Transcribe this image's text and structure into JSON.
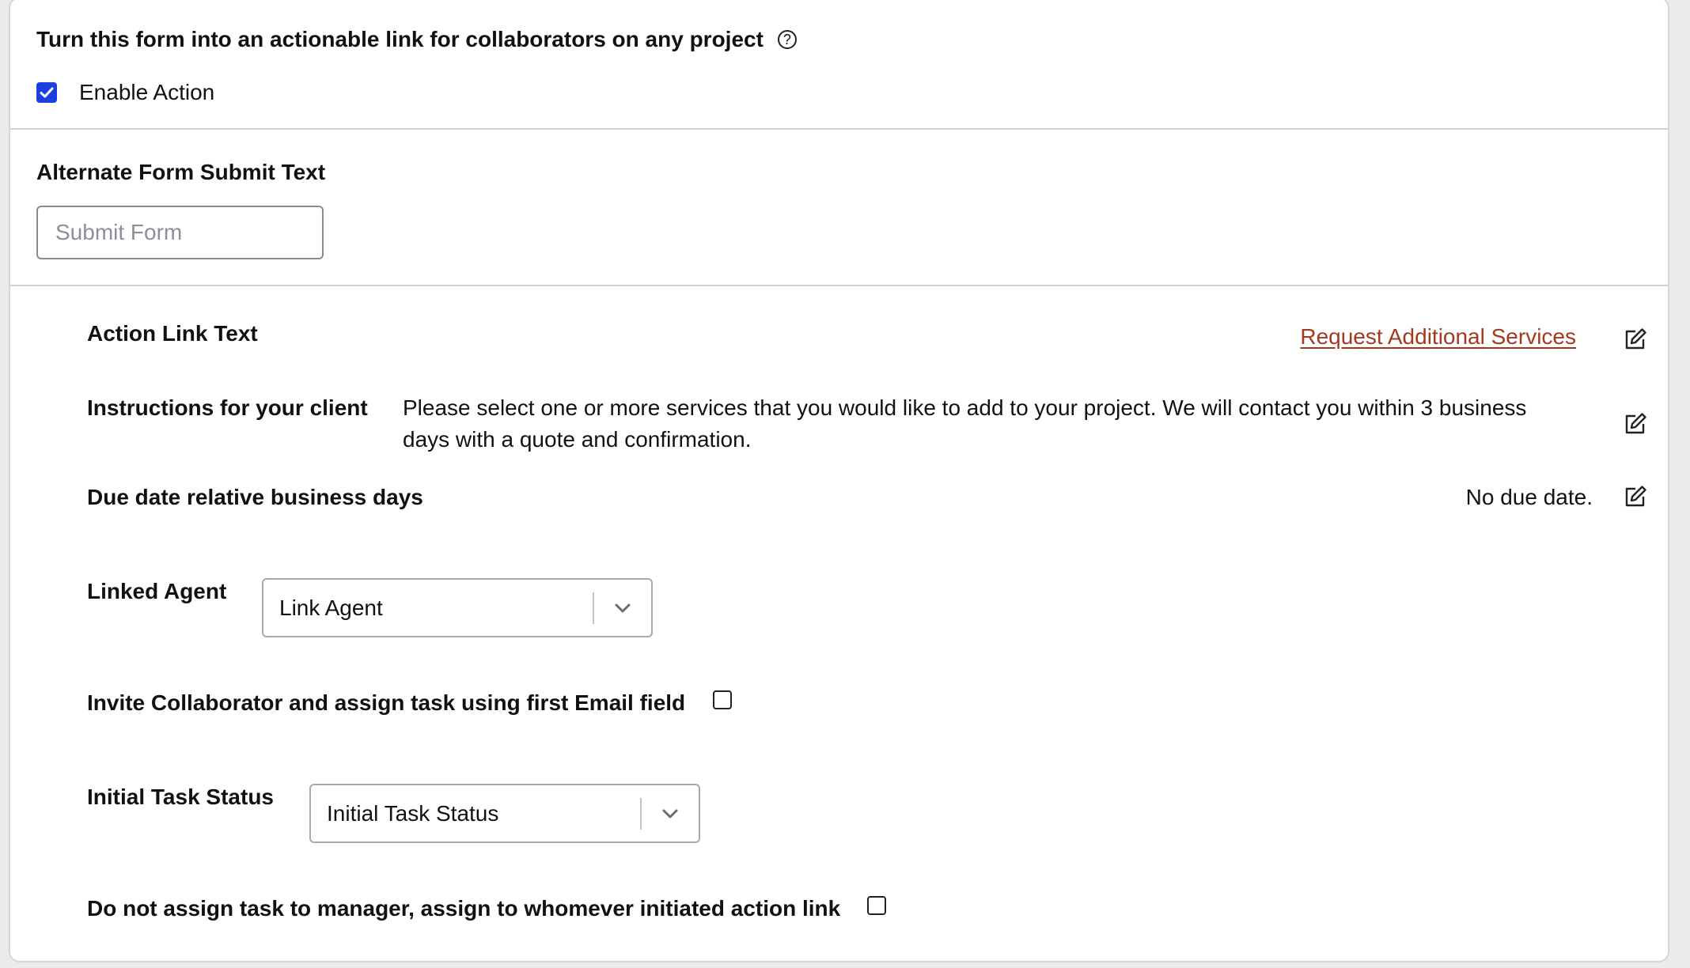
{
  "action_section": {
    "heading": "Turn this form into an actionable link for collaborators on any project",
    "enable_label": "Enable Action",
    "enabled": true
  },
  "submit_section": {
    "heading": "Alternate Form Submit Text",
    "placeholder": "Submit Form",
    "value": ""
  },
  "settings": {
    "action_link_text": {
      "label": "Action Link Text",
      "value": "Request Additional Services"
    },
    "instructions": {
      "label": "Instructions for your client",
      "line1": "Please select one or more services that you would like to add to your project. We will contact you within 3 business",
      "line2": "days with a quote and confirmation."
    },
    "due_date": {
      "label": "Due date relative business days",
      "value": "No due date."
    },
    "linked_agent": {
      "label": "Linked Agent",
      "selected": "Link Agent"
    },
    "invite_collaborator": {
      "label": "Invite Collaborator and assign task using first Email field",
      "checked": false
    },
    "initial_task_status": {
      "label": "Initial Task Status",
      "selected": "Initial Task Status"
    },
    "no_assign_manager": {
      "label": "Do not assign task to manager, assign to whomever initiated action link",
      "checked": false
    }
  },
  "colors": {
    "checkbox_accent": "#1c3fe0",
    "link": "#a33a20",
    "placeholder": "#8a8f9a"
  },
  "icons": {
    "help": "question-circle",
    "edit": "pencil-square",
    "dropdown": "chevron-down",
    "check": "checkmark"
  }
}
